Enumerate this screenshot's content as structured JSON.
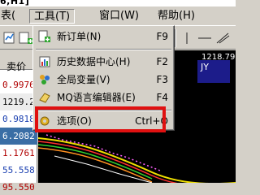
{
  "title_fragment": "6,H1]",
  "menubar": {
    "items": [
      {
        "label": "表(",
        "active": false
      },
      {
        "label": "工具(T)",
        "active": true
      },
      {
        "label": "窗口(W)",
        "active": false
      },
      {
        "label": "帮助(H)",
        "active": false
      }
    ]
  },
  "dropdown": {
    "items": [
      {
        "label": "新订单(N)",
        "shortcut": "F9",
        "icon": "new-order-icon"
      },
      {
        "label": "历史数据中心(H)",
        "shortcut": "F2",
        "icon": "history-center-icon"
      },
      {
        "label": "全局变量(V)",
        "shortcut": "F3",
        "icon": "global-variables-icon"
      },
      {
        "label": "MQ语言编辑器(E)",
        "shortcut": "F4",
        "icon": "editor-icon"
      },
      {
        "label": "选项(O)",
        "shortcut": "Ctrl+O",
        "icon": "options-icon"
      }
    ]
  },
  "market_watch": {
    "header": "卖价",
    "rows": [
      "0.9976",
      "1219.2",
      "0.9818",
      "6.2082",
      "1.1761",
      "55.558",
      "95.550"
    ]
  },
  "chart": {
    "price_label": "1218.79",
    "box_label": "JY"
  },
  "colors": {
    "highlight": "#e01010",
    "selected_row": "#3a6ea5",
    "chart_bg": "#000000"
  }
}
